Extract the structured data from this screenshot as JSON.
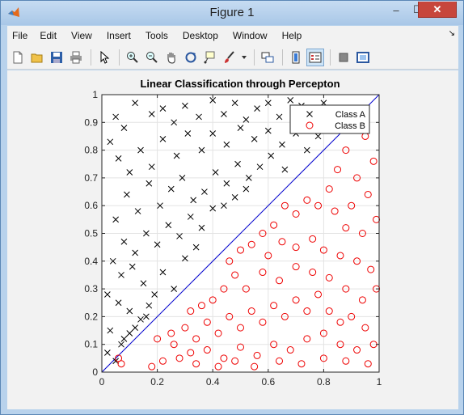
{
  "window": {
    "title": "Figure 1",
    "controls": {
      "minimize": "–",
      "maximize": "☐",
      "close": "✕"
    }
  },
  "menubar": {
    "items": [
      "File",
      "Edit",
      "View",
      "Insert",
      "Tools",
      "Desktop",
      "Window",
      "Help"
    ],
    "dock_arrow": "↘"
  },
  "toolbar": {
    "icons": [
      "new-figure-icon",
      "open-file-icon",
      "save-icon",
      "print-icon",
      "edit-plot-arrow-icon",
      "zoom-in-icon",
      "zoom-out-icon",
      "pan-hand-icon",
      "rotate-3d-icon",
      "data-cursor-icon",
      "brush-icon",
      "link-plot-icon",
      "insert-colorbar-icon",
      "insert-legend-icon",
      "hide-plot-tools-icon",
      "show-plot-tools-icon"
    ]
  },
  "colors": {
    "class_a": "#000000",
    "class_b": "#ee0000",
    "boundary": "#0000cc"
  },
  "chart_data": {
    "type": "scatter",
    "title": "Linear Classification through Percepton",
    "xlabel": "",
    "ylabel": "",
    "xlim": [
      0,
      1
    ],
    "ylim": [
      0,
      1
    ],
    "xticks": [
      "0",
      "0.2",
      "0.4",
      "0.6",
      "0.8",
      "1"
    ],
    "yticks": [
      "0",
      "0.1",
      "0.2",
      "0.3",
      "0.4",
      "0.5",
      "0.6",
      "0.7",
      "0.8",
      "0.9",
      "1"
    ],
    "grid": true,
    "legend": {
      "placement": "top-right",
      "entries": [
        "Class A",
        "Class B"
      ]
    },
    "boundary_line": {
      "points": [
        [
          0,
          0
        ],
        [
          1,
          1
        ]
      ]
    },
    "series": [
      {
        "name": "Class A",
        "marker": "x",
        "points": [
          [
            0.05,
            0.92
          ],
          [
            0.03,
            0.83
          ],
          [
            0.08,
            0.88
          ],
          [
            0.12,
            0.97
          ],
          [
            0.18,
            0.93
          ],
          [
            0.22,
            0.95
          ],
          [
            0.26,
            0.9
          ],
          [
            0.3,
            0.96
          ],
          [
            0.35,
            0.92
          ],
          [
            0.4,
            0.98
          ],
          [
            0.44,
            0.93
          ],
          [
            0.48,
            0.97
          ],
          [
            0.52,
            0.91
          ],
          [
            0.56,
            0.95
          ],
          [
            0.6,
            0.97
          ],
          [
            0.64,
            0.92
          ],
          [
            0.68,
            0.98
          ],
          [
            0.72,
            0.96
          ],
          [
            0.76,
            0.9
          ],
          [
            0.8,
            0.97
          ],
          [
            0.06,
            0.77
          ],
          [
            0.1,
            0.72
          ],
          [
            0.14,
            0.8
          ],
          [
            0.18,
            0.74
          ],
          [
            0.22,
            0.84
          ],
          [
            0.27,
            0.78
          ],
          [
            0.31,
            0.86
          ],
          [
            0.36,
            0.8
          ],
          [
            0.4,
            0.86
          ],
          [
            0.45,
            0.82
          ],
          [
            0.5,
            0.88
          ],
          [
            0.55,
            0.84
          ],
          [
            0.6,
            0.87
          ],
          [
            0.65,
            0.82
          ],
          [
            0.7,
            0.86
          ],
          [
            0.74,
            0.8
          ],
          [
            0.78,
            0.85
          ],
          [
            0.09,
            0.64
          ],
          [
            0.13,
            0.58
          ],
          [
            0.17,
            0.68
          ],
          [
            0.21,
            0.6
          ],
          [
            0.25,
            0.66
          ],
          [
            0.29,
            0.7
          ],
          [
            0.33,
            0.62
          ],
          [
            0.37,
            0.65
          ],
          [
            0.41,
            0.72
          ],
          [
            0.45,
            0.68
          ],
          [
            0.49,
            0.75
          ],
          [
            0.53,
            0.7
          ],
          [
            0.57,
            0.74
          ],
          [
            0.61,
            0.78
          ],
          [
            0.66,
            0.73
          ],
          [
            0.05,
            0.55
          ],
          [
            0.08,
            0.47
          ],
          [
            0.12,
            0.43
          ],
          [
            0.16,
            0.5
          ],
          [
            0.2,
            0.46
          ],
          [
            0.24,
            0.53
          ],
          [
            0.28,
            0.49
          ],
          [
            0.32,
            0.56
          ],
          [
            0.36,
            0.52
          ],
          [
            0.4,
            0.59
          ],
          [
            0.44,
            0.6
          ],
          [
            0.48,
            0.63
          ],
          [
            0.52,
            0.66
          ],
          [
            0.04,
            0.4
          ],
          [
            0.07,
            0.35
          ],
          [
            0.11,
            0.38
          ],
          [
            0.15,
            0.32
          ],
          [
            0.19,
            0.28
          ],
          [
            0.22,
            0.36
          ],
          [
            0.26,
            0.3
          ],
          [
            0.3,
            0.41
          ],
          [
            0.34,
            0.45
          ],
          [
            0.02,
            0.28
          ],
          [
            0.06,
            0.25
          ],
          [
            0.1,
            0.22
          ],
          [
            0.14,
            0.19
          ],
          [
            0.17,
            0.24
          ],
          [
            0.03,
            0.15
          ],
          [
            0.07,
            0.1
          ],
          [
            0.1,
            0.14
          ],
          [
            0.02,
            0.07
          ],
          [
            0.05,
            0.04
          ],
          [
            0.08,
            0.12
          ],
          [
            0.12,
            0.16
          ],
          [
            0.16,
            0.2
          ]
        ]
      },
      {
        "name": "Class B",
        "marker": "o",
        "points": [
          [
            0.95,
            0.85
          ],
          [
            0.98,
            0.76
          ],
          [
            0.92,
            0.7
          ],
          [
            0.88,
            0.8
          ],
          [
            0.85,
            0.73
          ],
          [
            0.82,
            0.66
          ],
          [
            0.9,
            0.6
          ],
          [
            0.96,
            0.64
          ],
          [
            0.99,
            0.55
          ],
          [
            0.94,
            0.5
          ],
          [
            0.88,
            0.52
          ],
          [
            0.84,
            0.58
          ],
          [
            0.78,
            0.6
          ],
          [
            0.74,
            0.62
          ],
          [
            0.7,
            0.57
          ],
          [
            0.66,
            0.6
          ],
          [
            0.62,
            0.53
          ],
          [
            0.58,
            0.5
          ],
          [
            0.54,
            0.46
          ],
          [
            0.5,
            0.44
          ],
          [
            0.46,
            0.4
          ],
          [
            0.6,
            0.42
          ],
          [
            0.65,
            0.47
          ],
          [
            0.7,
            0.45
          ],
          [
            0.76,
            0.48
          ],
          [
            0.8,
            0.44
          ],
          [
            0.86,
            0.42
          ],
          [
            0.92,
            0.4
          ],
          [
            0.97,
            0.37
          ],
          [
            0.99,
            0.3
          ],
          [
            0.94,
            0.26
          ],
          [
            0.88,
            0.3
          ],
          [
            0.82,
            0.34
          ],
          [
            0.76,
            0.36
          ],
          [
            0.7,
            0.38
          ],
          [
            0.64,
            0.33
          ],
          [
            0.58,
            0.36
          ],
          [
            0.52,
            0.3
          ],
          [
            0.48,
            0.35
          ],
          [
            0.44,
            0.3
          ],
          [
            0.4,
            0.26
          ],
          [
            0.36,
            0.24
          ],
          [
            0.32,
            0.22
          ],
          [
            0.3,
            0.16
          ],
          [
            0.34,
            0.12
          ],
          [
            0.38,
            0.18
          ],
          [
            0.42,
            0.14
          ],
          [
            0.46,
            0.2
          ],
          [
            0.5,
            0.16
          ],
          [
            0.54,
            0.22
          ],
          [
            0.58,
            0.18
          ],
          [
            0.62,
            0.24
          ],
          [
            0.66,
            0.2
          ],
          [
            0.7,
            0.26
          ],
          [
            0.74,
            0.22
          ],
          [
            0.78,
            0.28
          ],
          [
            0.82,
            0.22
          ],
          [
            0.86,
            0.18
          ],
          [
            0.9,
            0.2
          ],
          [
            0.95,
            0.16
          ],
          [
            0.98,
            0.1
          ],
          [
            0.92,
            0.08
          ],
          [
            0.86,
            0.1
          ],
          [
            0.8,
            0.14
          ],
          [
            0.74,
            0.12
          ],
          [
            0.68,
            0.08
          ],
          [
            0.62,
            0.1
          ],
          [
            0.56,
            0.06
          ],
          [
            0.5,
            0.09
          ],
          [
            0.44,
            0.05
          ],
          [
            0.38,
            0.08
          ],
          [
            0.32,
            0.07
          ],
          [
            0.26,
            0.1
          ],
          [
            0.22,
            0.04
          ],
          [
            0.18,
            0.02
          ],
          [
            0.2,
            0.12
          ],
          [
            0.25,
            0.14
          ],
          [
            0.28,
            0.05
          ],
          [
            0.34,
            0.03
          ],
          [
            0.42,
            0.02
          ],
          [
            0.48,
            0.04
          ],
          [
            0.55,
            0.02
          ],
          [
            0.64,
            0.04
          ],
          [
            0.72,
            0.03
          ],
          [
            0.8,
            0.05
          ],
          [
            0.88,
            0.04
          ],
          [
            0.96,
            0.03
          ],
          [
            0.07,
            0.03
          ],
          [
            0.06,
            0.05
          ]
        ]
      }
    ]
  }
}
